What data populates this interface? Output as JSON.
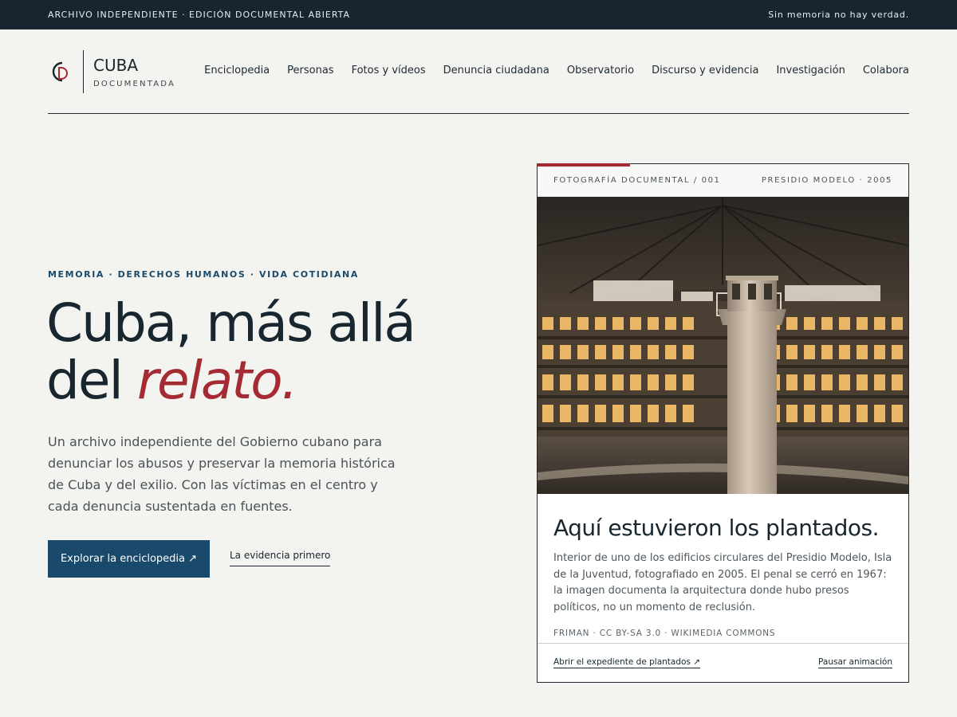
{
  "topbar": {
    "left": "ARCHIVO INDEPENDIENTE · EDICIÓN DOCUMENTAL ABIERTA",
    "right": "Sin memoria no hay verdad."
  },
  "brand": {
    "title": "CUBA",
    "subtitle": "DOCUMENTADA",
    "mark_icon": "cd-monogram-icon",
    "colors": {
      "dark": "#17262f",
      "accent": "#a52b33"
    }
  },
  "nav": {
    "items": [
      {
        "label": "Enciclopedia"
      },
      {
        "label": "Personas"
      },
      {
        "label": "Fotos y vídeos"
      },
      {
        "label": "Denuncia ciudadana"
      },
      {
        "label": "Observatorio"
      },
      {
        "label": "Discurso y evidencia"
      },
      {
        "label": "Investigación"
      },
      {
        "label": "Colabora"
      }
    ]
  },
  "hero": {
    "eyebrow": "MEMORIA · DERECHOS HUMANOS · VIDA COTIDIANA",
    "headline_line1": "Cuba, más allá",
    "headline_line2_plain": "del ",
    "headline_line2_accent": "relato.",
    "lead": "Un archivo independiente del Gobierno cubano para denunciar los abusos y preservar la memoria histórica de Cuba y del exilio. Con las víctimas en el centro y cada denuncia sustentada en fuentes.",
    "primary_cta": "Explorar la enciclopedia ↗",
    "secondary_link": "La evidencia primero",
    "colors": {
      "primary": "#1a4a6b",
      "accent": "#a52b33"
    }
  },
  "card": {
    "kicker_left": "FOTOGRAFÍA DOCUMENTAL / 001",
    "kicker_right": "PRESIDIO MODELO · 2005",
    "title": "Aquí estuvieron los plantados.",
    "text": "Interior de uno de los edificios circulares del Presidio Modelo, Isla de la Juventud, fotografiado en 2005. El penal se cerró en 1967: la imagen documenta la arquitectura donde hubo presos políticos, no un momento de reclusión.",
    "credit": "FRIMAN · CC BY-SA 3.0 · WIKIMEDIA COMMONS",
    "link_left": "Abrir el expediente de plantados ↗",
    "link_right": "Pausar animación"
  }
}
